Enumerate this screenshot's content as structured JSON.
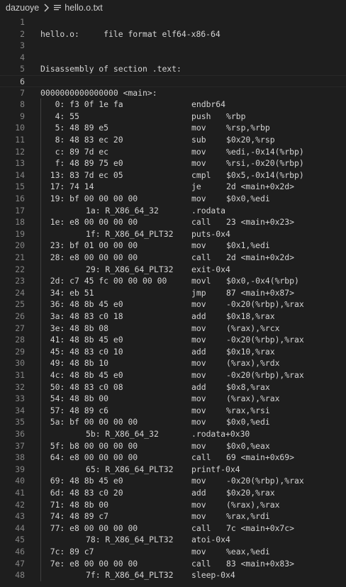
{
  "breadcrumb": {
    "folder": "dazuoye",
    "file": "hello.o.txt",
    "separator_icon": "chevron-right-icon",
    "file_icon": "text-file-icon"
  },
  "editor": {
    "current_line": 6,
    "lines": [
      {
        "n": "1",
        "kind": "text",
        "text": ""
      },
      {
        "n": "2",
        "kind": "text",
        "text": "hello.o:     file format elf64-x86-64"
      },
      {
        "n": "3",
        "kind": "text",
        "text": ""
      },
      {
        "n": "4",
        "kind": "text",
        "text": ""
      },
      {
        "n": "5",
        "kind": "text",
        "text": "Disassembly of section .text:"
      },
      {
        "n": "6",
        "kind": "text",
        "text": ""
      },
      {
        "n": "7",
        "kind": "text",
        "text": "0000000000000000 <main>:"
      },
      {
        "n": "8",
        "kind": "ins",
        "a": "   0: f3 0f 1e fa",
        "b": "endbr64",
        "c": ""
      },
      {
        "n": "9",
        "kind": "ins",
        "a": "   4: 55",
        "b": "push",
        "c": "%rbp"
      },
      {
        "n": "10",
        "kind": "ins",
        "a": "   5: 48 89 e5",
        "b": "mov",
        "c": "%rsp,%rbp"
      },
      {
        "n": "11",
        "kind": "ins",
        "a": "   8: 48 83 ec 20",
        "b": "sub",
        "c": "$0x20,%rsp"
      },
      {
        "n": "12",
        "kind": "ins",
        "a": "   c: 89 7d ec",
        "b": "mov",
        "c": "%edi,-0x14(%rbp)"
      },
      {
        "n": "13",
        "kind": "ins",
        "a": "   f: 48 89 75 e0",
        "b": "mov",
        "c": "%rsi,-0x20(%rbp)"
      },
      {
        "n": "14",
        "kind": "ins",
        "a": "  13: 83 7d ec 05",
        "b": "cmpl",
        "c": "$0x5,-0x14(%rbp)"
      },
      {
        "n": "15",
        "kind": "ins",
        "a": "  17: 74 14",
        "b": "je",
        "c": "2d <main+0x2d>"
      },
      {
        "n": "16",
        "kind": "ins",
        "a": "  19: bf 00 00 00 00",
        "b": "mov",
        "c": "$0x0,%edi"
      },
      {
        "n": "17",
        "kind": "reloc",
        "a": "1a: R_X86_64_32",
        "b": ".rodata"
      },
      {
        "n": "18",
        "kind": "ins",
        "a": "  1e: e8 00 00 00 00",
        "b": "call",
        "c": "23 <main+0x23>"
      },
      {
        "n": "19",
        "kind": "reloc",
        "a": "1f: R_X86_64_PLT32",
        "b": "puts-0x4"
      },
      {
        "n": "20",
        "kind": "ins",
        "a": "  23: bf 01 00 00 00",
        "b": "mov",
        "c": "$0x1,%edi"
      },
      {
        "n": "21",
        "kind": "ins",
        "a": "  28: e8 00 00 00 00",
        "b": "call",
        "c": "2d <main+0x2d>"
      },
      {
        "n": "22",
        "kind": "reloc",
        "a": "29: R_X86_64_PLT32",
        "b": "exit-0x4"
      },
      {
        "n": "23",
        "kind": "ins",
        "a": "  2d: c7 45 fc 00 00 00 00",
        "b": "movl",
        "c": "$0x0,-0x4(%rbp)"
      },
      {
        "n": "24",
        "kind": "ins",
        "a": "  34: eb 51",
        "b": "jmp",
        "c": "87 <main+0x87>"
      },
      {
        "n": "25",
        "kind": "ins",
        "a": "  36: 48 8b 45 e0",
        "b": "mov",
        "c": "-0x20(%rbp),%rax"
      },
      {
        "n": "26",
        "kind": "ins",
        "a": "  3a: 48 83 c0 18",
        "b": "add",
        "c": "$0x18,%rax"
      },
      {
        "n": "27",
        "kind": "ins",
        "a": "  3e: 48 8b 08",
        "b": "mov",
        "c": "(%rax),%rcx"
      },
      {
        "n": "28",
        "kind": "ins",
        "a": "  41: 48 8b 45 e0",
        "b": "mov",
        "c": "-0x20(%rbp),%rax"
      },
      {
        "n": "29",
        "kind": "ins",
        "a": "  45: 48 83 c0 10",
        "b": "add",
        "c": "$0x10,%rax"
      },
      {
        "n": "30",
        "kind": "ins",
        "a": "  49: 48 8b 10",
        "b": "mov",
        "c": "(%rax),%rdx"
      },
      {
        "n": "31",
        "kind": "ins",
        "a": "  4c: 48 8b 45 e0",
        "b": "mov",
        "c": "-0x20(%rbp),%rax"
      },
      {
        "n": "32",
        "kind": "ins",
        "a": "  50: 48 83 c0 08",
        "b": "add",
        "c": "$0x8,%rax"
      },
      {
        "n": "33",
        "kind": "ins",
        "a": "  54: 48 8b 00",
        "b": "mov",
        "c": "(%rax),%rax"
      },
      {
        "n": "34",
        "kind": "ins",
        "a": "  57: 48 89 c6",
        "b": "mov",
        "c": "%rax,%rsi"
      },
      {
        "n": "35",
        "kind": "ins",
        "a": "  5a: bf 00 00 00 00",
        "b": "mov",
        "c": "$0x0,%edi"
      },
      {
        "n": "36",
        "kind": "reloc",
        "a": "5b: R_X86_64_32",
        "b": ".rodata+0x30"
      },
      {
        "n": "37",
        "kind": "ins",
        "a": "  5f: b8 00 00 00 00",
        "b": "mov",
        "c": "$0x0,%eax"
      },
      {
        "n": "38",
        "kind": "ins",
        "a": "  64: e8 00 00 00 00",
        "b": "call",
        "c": "69 <main+0x69>"
      },
      {
        "n": "39",
        "kind": "reloc",
        "a": "65: R_X86_64_PLT32",
        "b": "printf-0x4"
      },
      {
        "n": "40",
        "kind": "ins",
        "a": "  69: 48 8b 45 e0",
        "b": "mov",
        "c": "-0x20(%rbp),%rax"
      },
      {
        "n": "41",
        "kind": "ins",
        "a": "  6d: 48 83 c0 20",
        "b": "add",
        "c": "$0x20,%rax"
      },
      {
        "n": "42",
        "kind": "ins",
        "a": "  71: 48 8b 00",
        "b": "mov",
        "c": "(%rax),%rax"
      },
      {
        "n": "43",
        "kind": "ins",
        "a": "  74: 48 89 c7",
        "b": "mov",
        "c": "%rax,%rdi"
      },
      {
        "n": "44",
        "kind": "ins",
        "a": "  77: e8 00 00 00 00",
        "b": "call",
        "c": "7c <main+0x7c>"
      },
      {
        "n": "45",
        "kind": "reloc",
        "a": "78: R_X86_64_PLT32",
        "b": "atoi-0x4"
      },
      {
        "n": "46",
        "kind": "ins",
        "a": "  7c: 89 c7",
        "b": "mov",
        "c": "%eax,%edi"
      },
      {
        "n": "47",
        "kind": "ins",
        "a": "  7e: e8 00 00 00 00",
        "b": "call",
        "c": "83 <main+0x83>"
      },
      {
        "n": "48",
        "kind": "reloc",
        "a": "7f: R_X86_64_PLT32",
        "b": "sleep-0x4"
      }
    ]
  }
}
